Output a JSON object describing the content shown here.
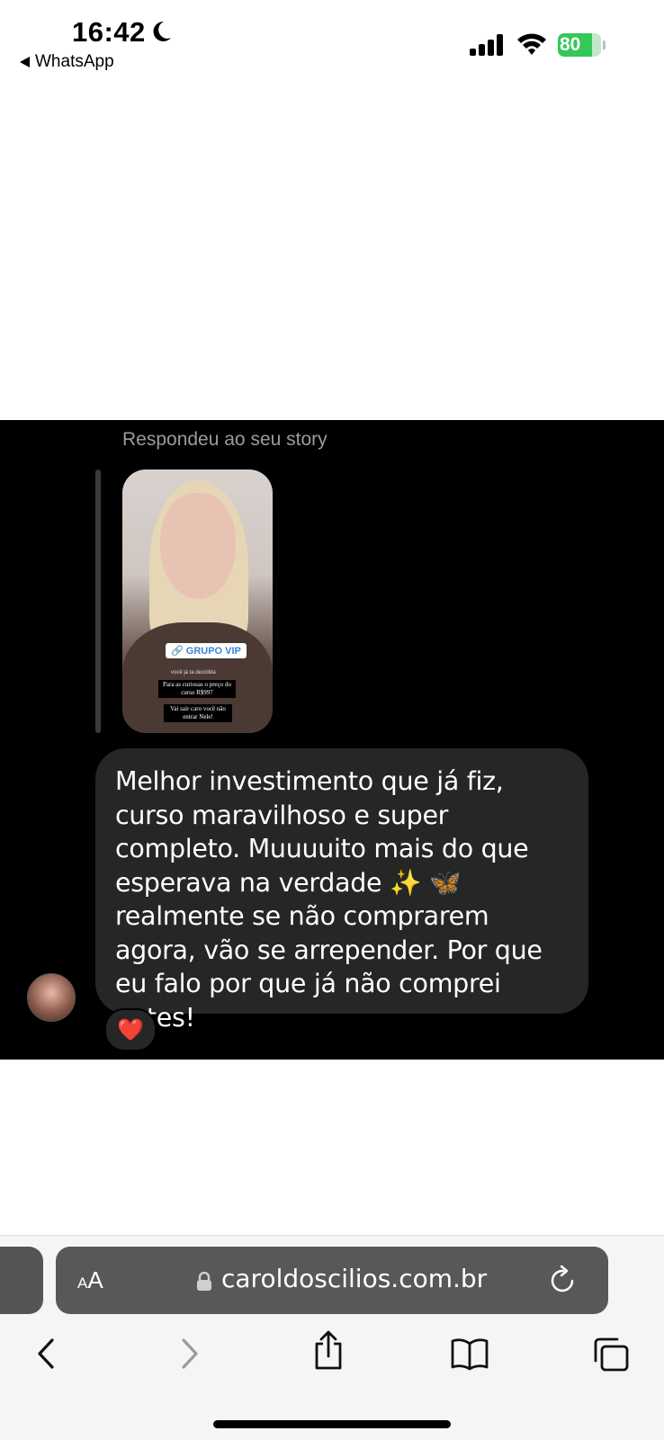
{
  "status_bar": {
    "time": "16:42",
    "back_app": "WhatsApp",
    "battery": "80",
    "battery_level_percent": 80,
    "battery_color": "#35c759"
  },
  "story_reply": {
    "label": "Respondeu ao seu story",
    "thumbnail": {
      "tag": "GRUPO VIP",
      "caption_1": "você já ta decidida",
      "caption_2": "Para as curiosas o preço do curso R$997",
      "caption_3": "Vai sair caro você não entrar Nele!"
    },
    "message": "Melhor investimento que já fiz, curso maravilhoso e super completo. Muuuuito mais do que esperava na verdade ✨ 🦋 realmente se não comprarem agora, vão se arrepender. Por que eu falo por que já não comprei antes!",
    "reaction": "❤️"
  },
  "safari": {
    "reader_label_small": "A",
    "reader_label_large": "A",
    "url": "caroldoscilios.com.br",
    "icons": [
      "back-icon",
      "forward-icon",
      "share-icon",
      "bookmarks-icon",
      "tabs-icon",
      "reload-icon",
      "lock-icon"
    ]
  }
}
